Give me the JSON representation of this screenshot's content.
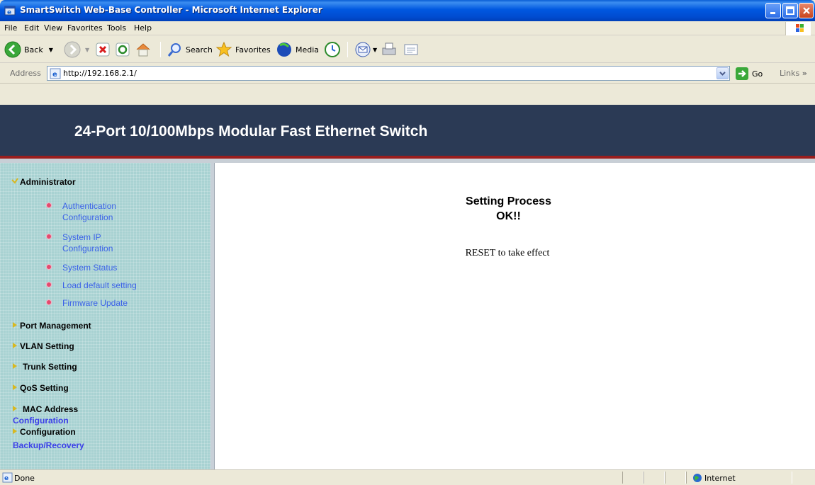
{
  "window": {
    "title": "SmartSwitch Web-Base Controller - Microsoft Internet Explorer"
  },
  "menu": [
    "File",
    "Edit",
    "View",
    "Favorites",
    "Tools",
    "Help"
  ],
  "toolbar": {
    "back_label": "Back",
    "search_label": "Search",
    "favorites_label": "Favorites",
    "media_label": "Media"
  },
  "address": {
    "label": "Address",
    "url": "http://192.168.2.1/",
    "go_label": "Go",
    "links_label": "Links"
  },
  "banner": {
    "title": "24-Port 10/100Mbps Modular Fast Ethernet Switch"
  },
  "sidebar": {
    "administrator": "Administrator",
    "sub_items": [
      {
        "line1": "Authentication",
        "line2": "Configuration"
      },
      {
        "line1": "System IP",
        "line2": "Configuration"
      },
      {
        "line1": "System Status",
        "line2": ""
      },
      {
        "line1": "Load default setting",
        "line2": ""
      },
      {
        "line1": "Firmware Update",
        "line2": ""
      }
    ],
    "port_management": "Port Management",
    "vlan_setting": "VLAN Setting",
    "trunk_setting": "Trunk Setting",
    "qos_setting": "QoS Setting",
    "mac_address": "MAC Address",
    "mac_configuration": "Configuration",
    "configuration": "Configuration",
    "backup_recovery": "Backup/Recovery"
  },
  "main": {
    "title_line1": "Setting Process",
    "title_line2": "OK!!",
    "message": "RESET to take effect"
  },
  "status": {
    "text": "Done",
    "zone": "Internet"
  }
}
